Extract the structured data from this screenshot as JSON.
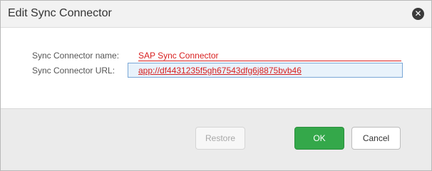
{
  "dialog": {
    "title": "Edit Sync Connector",
    "close_icon": "close-circle-icon"
  },
  "form": {
    "name_label": "Sync Connector name:",
    "name_value": "SAP Sync Connector",
    "url_label": "Sync Connector URL:",
    "url_value": "app://df4431235f5gh67543dfg6j8875bvb46"
  },
  "buttons": {
    "restore": "Restore",
    "ok": "OK",
    "cancel": "Cancel"
  },
  "colors": {
    "value_text": "#d82020",
    "ok_button": "#34a84a",
    "url_focus_border": "#7aa7d6"
  }
}
